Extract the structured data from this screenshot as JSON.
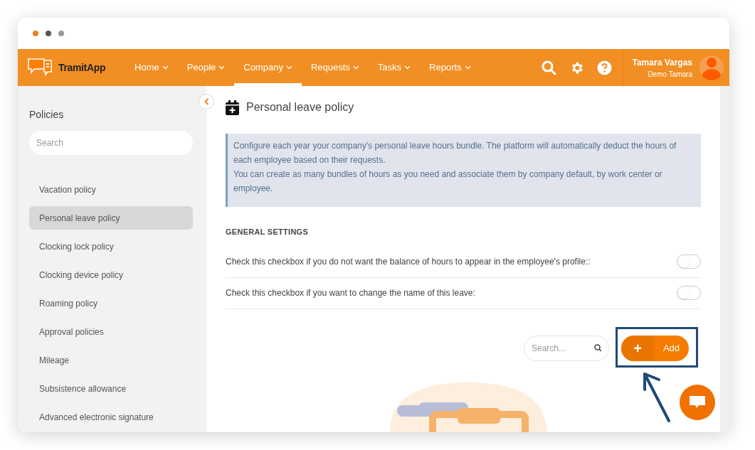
{
  "app": {
    "logo_text": "TramitApp"
  },
  "nav": [
    {
      "label": "Home",
      "selected": false
    },
    {
      "label": "People",
      "selected": false
    },
    {
      "label": "Company",
      "selected": true
    },
    {
      "label": "Requests",
      "selected": false
    },
    {
      "label": "Tasks",
      "selected": false
    },
    {
      "label": "Reports",
      "selected": false
    }
  ],
  "user": {
    "name": "Tamara Vargas",
    "subtitle": "Demo Tamara"
  },
  "sidebar": {
    "title": "Policies",
    "search_placeholder": "Search",
    "items": [
      {
        "label": "Vacation policy",
        "selected": false
      },
      {
        "label": "Personal leave policy",
        "selected": true
      },
      {
        "label": "Clocking lock policy",
        "selected": false
      },
      {
        "label": "Clocking device policy",
        "selected": false
      },
      {
        "label": "Roaming policy",
        "selected": false
      },
      {
        "label": "Approval policies",
        "selected": false
      },
      {
        "label": "Mileage",
        "selected": false
      },
      {
        "label": "Subsistence allowance",
        "selected": false
      },
      {
        "label": "Advanced electronic signature",
        "selected": false
      }
    ]
  },
  "page": {
    "title": "Personal leave policy",
    "info": [
      "Configure each year your company's personal leave hours bundle. The platform will automatically deduct the hours of each employee based on their requests.",
      "You can create as many bundles of hours as you need and associate them by company default, by work center or employee."
    ],
    "section_title": "GENERAL SETTINGS",
    "settings": [
      {
        "label": "Check this checkbox if you do not want the balance of hours to appear in the employee's profile::",
        "on": false
      },
      {
        "label": "Check this checkbox if you want to change the name of this leave:",
        "on": false
      }
    ],
    "search_placeholder": "Search...",
    "add_button": {
      "icon": "+",
      "label": "Add"
    }
  }
}
